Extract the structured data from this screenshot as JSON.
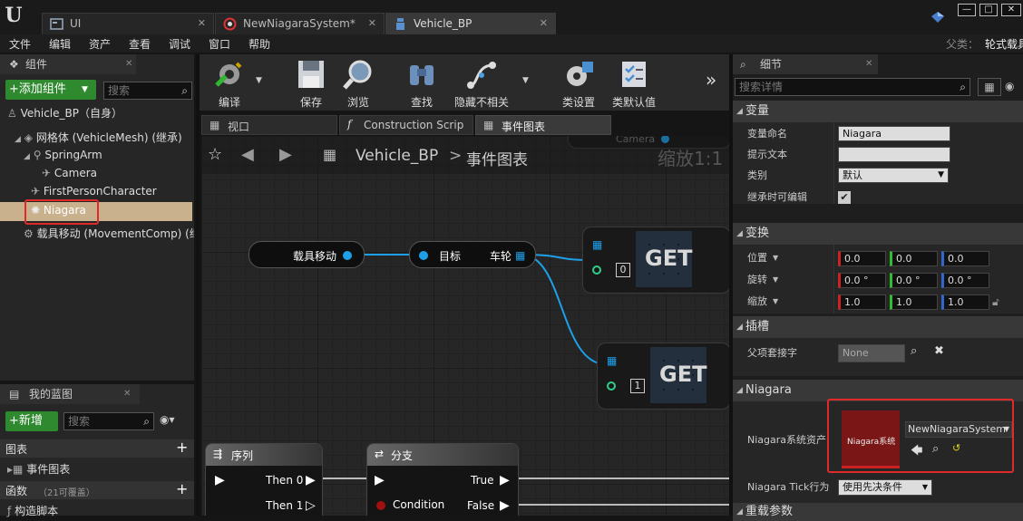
{
  "tabs": [
    {
      "label": "UI",
      "icon": "widget-icon"
    },
    {
      "label": "NewNiagaraSystem*",
      "icon": "niagara-system-icon"
    },
    {
      "label": "Vehicle_BP",
      "icon": "blueprint-icon"
    }
  ],
  "menu": [
    "文件",
    "编辑",
    "资产",
    "查看",
    "调试",
    "窗口",
    "帮助"
  ],
  "parent_class": {
    "label": "父类：",
    "value": "轮式载具"
  },
  "components": {
    "title": "组件",
    "add_button": "+添加组件",
    "search_placeholder": "搜索",
    "self_item": "Vehicle_BP（自身）",
    "items": [
      "网格体 (VehicleMesh) (继承)",
      "SpringArm",
      "Camera",
      "FirstPersonCharacter",
      "Niagara",
      "载具移动 (MovementComp) (继承)"
    ]
  },
  "my_blueprint": {
    "title": "我的蓝图",
    "add_button": "+新增",
    "search_placeholder": "搜索",
    "sections": {
      "graphs": "图表",
      "event_graph": "事件图表",
      "functions": "函数",
      "functions_count": "（21可覆盖）",
      "construct": "构造脚本"
    }
  },
  "toolbar": {
    "compile": "编译",
    "save": "保存",
    "browse": "浏览",
    "find": "查找",
    "hide_unrelated": "隐藏不相关",
    "class_settings": "类设置",
    "class_defaults": "类默认值"
  },
  "editor_tabs": [
    "视口",
    "Construction Scrip",
    "事件图表"
  ],
  "graph": {
    "breadcrumb_bp": "Vehicle_BP",
    "breadcrumb_sep": ">",
    "breadcrumb_graph": "事件图表",
    "zoom": "缩放1:1",
    "camera_label": "Camera",
    "node_vehicle_move": "载具移动",
    "node_target": "目标",
    "node_wheels": "车轮",
    "get_label": "GET",
    "get_index_0": "0",
    "get_index_1": "1",
    "sequence": {
      "title": "序列",
      "then0": "Then 0",
      "then1": "Then 1"
    },
    "branch": {
      "title": "分支",
      "condition": "Condition",
      "true_pin": "True",
      "false_pin": "False"
    }
  },
  "details": {
    "title": "细节",
    "search_placeholder": "搜索详情",
    "variable_section": "变量",
    "var_name_label": "变量命名",
    "var_name_value": "Niagara",
    "tooltip_label": "提示文本",
    "category_label": "类别",
    "category_value": "默认",
    "editable_label": "继承时可编辑",
    "transform_section": "变换",
    "location_label": "位置",
    "rotation_label": "旋转",
    "scale_label": "缩放",
    "location": [
      "0.0",
      "0.0",
      "0.0"
    ],
    "rotation": [
      "0.0 °",
      "0.0 °",
      "0.0 °"
    ],
    "scale": [
      "1.0",
      "1.0",
      "1.0"
    ],
    "socket_section": "插槽",
    "parent_socket_label": "父项套接字",
    "parent_socket_value": "None",
    "niagara_section": "Niagara",
    "niagara_asset_label": "Niagara系统资产",
    "niagara_thumb_label": "Niagara系统",
    "niagara_asset_value": "NewNiagaraSystem",
    "tick_label": "Niagara Tick行为",
    "tick_value": "使用先决条件",
    "override_section": "重载参数"
  },
  "colors": {
    "highlight_red": "#e02a2a",
    "selected_item": "#c9b18e",
    "add_green": "#2f8a2f",
    "wire_blue": "#1ea0e8",
    "niagara_thumb": "#7a1616"
  }
}
